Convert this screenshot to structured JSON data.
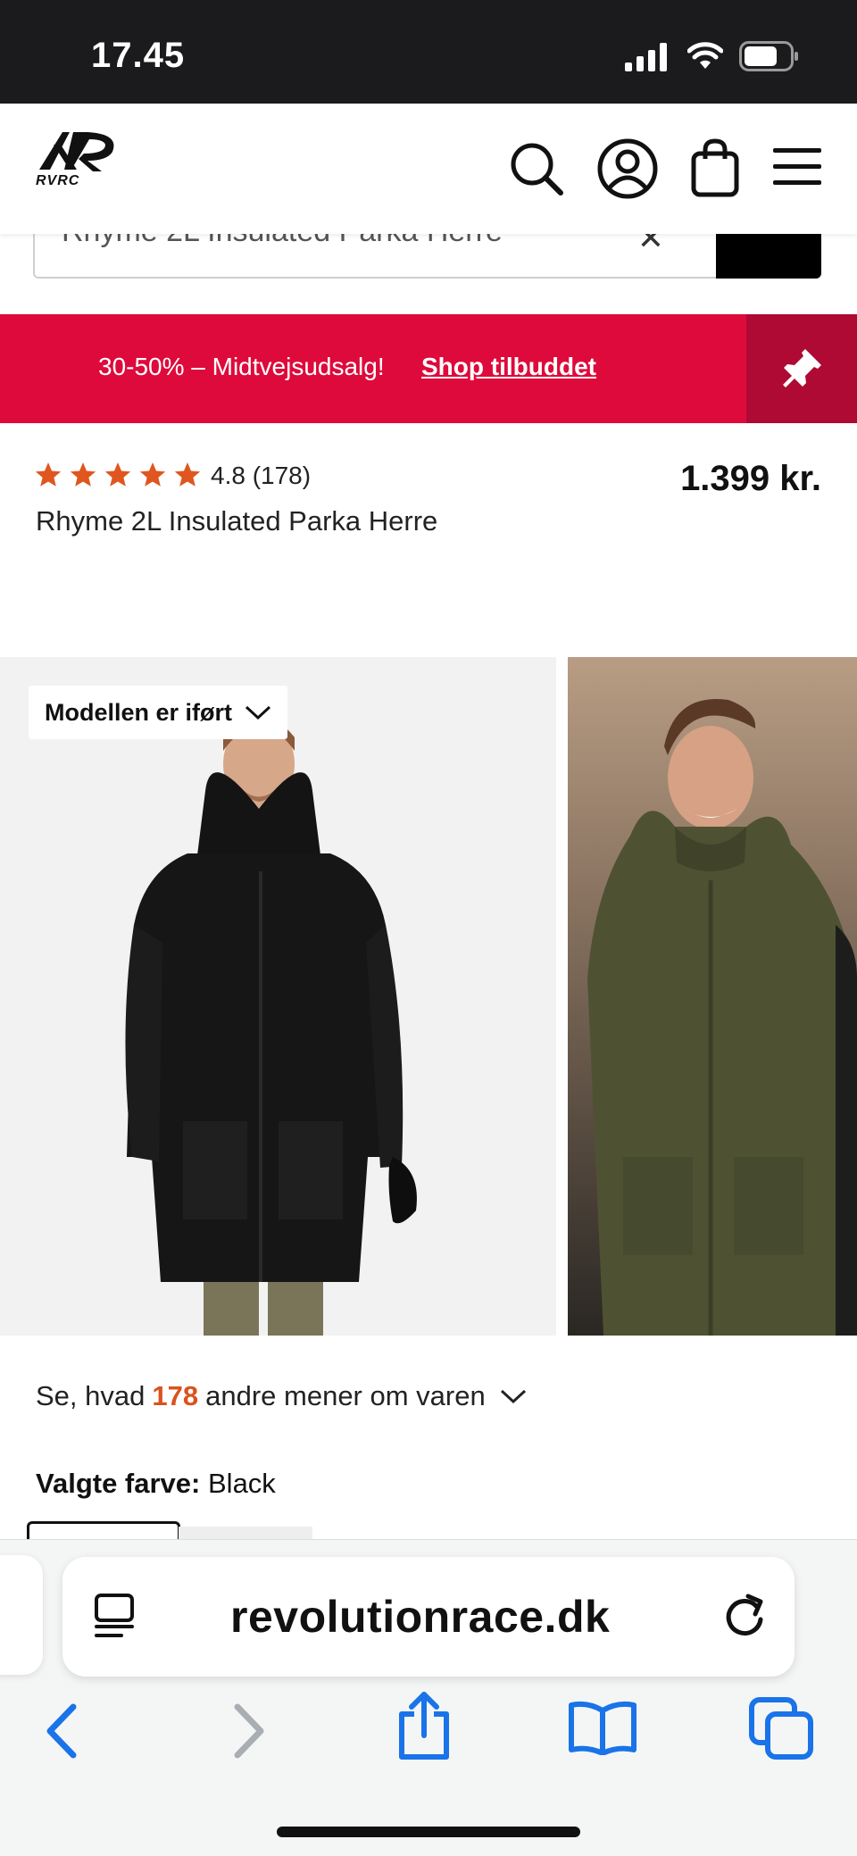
{
  "status_bar": {
    "time": "17.45",
    "icons": [
      "signal-icon",
      "wifi-icon",
      "battery-icon"
    ]
  },
  "header": {
    "logo_text": "RVRC",
    "icons": [
      "search-icon",
      "account-icon",
      "bag-icon",
      "menu-icon"
    ]
  },
  "search": {
    "value": "Rhyme 2L Insulated Parka Herre"
  },
  "promo": {
    "text": "30-50% – Midtvejsudsalg!",
    "link": "Shop tilbuddet",
    "background": "#de0a3b"
  },
  "product": {
    "rating_value": 4.8,
    "rating_text": "4.8 (178)",
    "stars": 5,
    "name": "Rhyme 2L Insulated Parka Herre",
    "price": "1.399 kr."
  },
  "gallery": {
    "model_tag": "Modellen er iført"
  },
  "reviews": {
    "prefix": "Se, hvad",
    "count": "178",
    "suffix": "andre mener om varen"
  },
  "color": {
    "label": "Valgte farve:",
    "value": "Black"
  },
  "browser": {
    "url": "revolutionrace.dk",
    "accent": "#1a73e8",
    "toolbar": [
      "back-icon",
      "forward-icon",
      "share-icon",
      "bookmarks-icon",
      "tabs-icon"
    ]
  }
}
